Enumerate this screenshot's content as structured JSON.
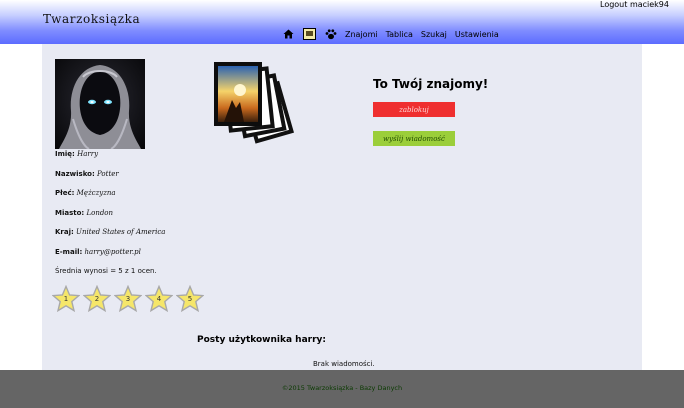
{
  "header": {
    "brand": "Twarzoksiązka",
    "logout": "Logout",
    "username": "maciek94",
    "nav_icons": [
      "home-icon",
      "messages-icon",
      "friends-paw-icon"
    ],
    "nav": [
      "Znajomi",
      "Tablica",
      "Szukaj",
      "Ustawienia"
    ]
  },
  "profile": {
    "avatar_icon": "hooded-figure-avatar",
    "photos_icon": "photo-stack-icon",
    "fields": [
      {
        "label": "Imię:",
        "value": "Harry"
      },
      {
        "label": "Nazwisko:",
        "value": "Potter"
      },
      {
        "label": "Płeć:",
        "value": "Mężczyzna"
      },
      {
        "label": "Miasto:",
        "value": "London"
      },
      {
        "label": "Kraj:",
        "value": "United States of America"
      },
      {
        "label": "E-mail:",
        "value": "harry@potter.pl"
      }
    ],
    "rating_text": "Średnia wynosi = 5 z 1 ocen.",
    "rating_value": 5,
    "rating_max": 5,
    "stars": [
      "1",
      "2",
      "3",
      "4",
      "5"
    ]
  },
  "friend": {
    "title": "To Twój znajomy!",
    "block_label": "zablokuj",
    "message_label": "wyślij wiadomość"
  },
  "posts": {
    "title": "Posty użytkownika harry:",
    "empty": "Brak wiadomości."
  },
  "footer": {
    "copyright": "©2015 Twarzoksiązka - Bazy Danych"
  },
  "colors": {
    "header_blue": "#5c6cff",
    "content_bg": "#e8eaf3",
    "block_red": "#ef2f2f",
    "message_green": "#9bce3a",
    "footer_gray": "#656565",
    "star_yellow": "#f5e66a"
  }
}
